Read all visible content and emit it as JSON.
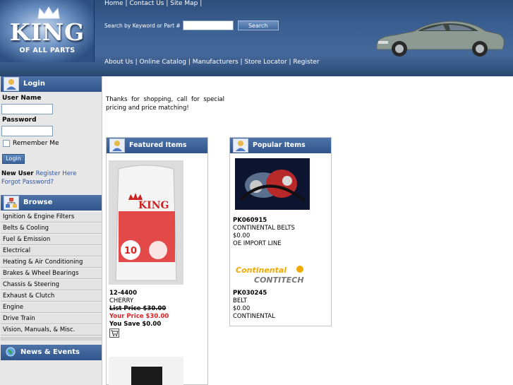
{
  "logo": {
    "title": "KING",
    "subtitle": "OF ALL PARTS"
  },
  "header": {
    "top_links": "Home | Contact Us | Site Map |",
    "search_label": "Search by Keyword or Part #",
    "search_value": "",
    "search_button": "Search",
    "bottom_links": "About Us | Online Catalog | Manufacturers | Store Locator | Register"
  },
  "login": {
    "title": "Login",
    "username_label": "User Name",
    "password_label": "Password",
    "remember_label": "Remember Me",
    "login_button": "Login",
    "new_user_label": "New User",
    "register_link": "Register Here",
    "forgot_link": "Forgot Password?"
  },
  "browse": {
    "title": "Browse",
    "items": [
      "Ignition & Engine Filters",
      "Belts & Cooling",
      "Fuel & Emission",
      "Electrical",
      "Heating & Air Conditioning",
      "Brakes & Wheel Bearings",
      "Chassis & Steering",
      "Exhaust & Clutch",
      "Engine",
      "Drive Train",
      "Vision, Manuals, & Misc."
    ]
  },
  "news": {
    "title": "News & Events"
  },
  "intro_text": "Thanks for shopping, call for special pricing and price matching!",
  "featured": {
    "title": "Featured Items",
    "item": {
      "sku": "12-4400",
      "name": "CHERRY",
      "list_price": "List Price $30.00",
      "your_price": "Your Price $30.00",
      "you_save": "You Save $0.00"
    }
  },
  "popular": {
    "title": "Popular Items",
    "items": [
      {
        "sku": "PK060915",
        "name": "CONTINENTAL BELTS",
        "price": "$0.00",
        "brand": "OE IMPORT LINE"
      },
      {
        "sku": "PK030245",
        "name": "BELT",
        "price": "$0.00",
        "brand": "CONTINENTAL"
      }
    ],
    "logo_line1": "Continental",
    "logo_line2": "CONTITECH"
  },
  "jug_label": {
    "brand": "KING",
    "number": "10"
  },
  "colors": {
    "header_blue": "#3b5f92",
    "accent_red": "#e02020",
    "link_blue": "#2d55a0"
  }
}
